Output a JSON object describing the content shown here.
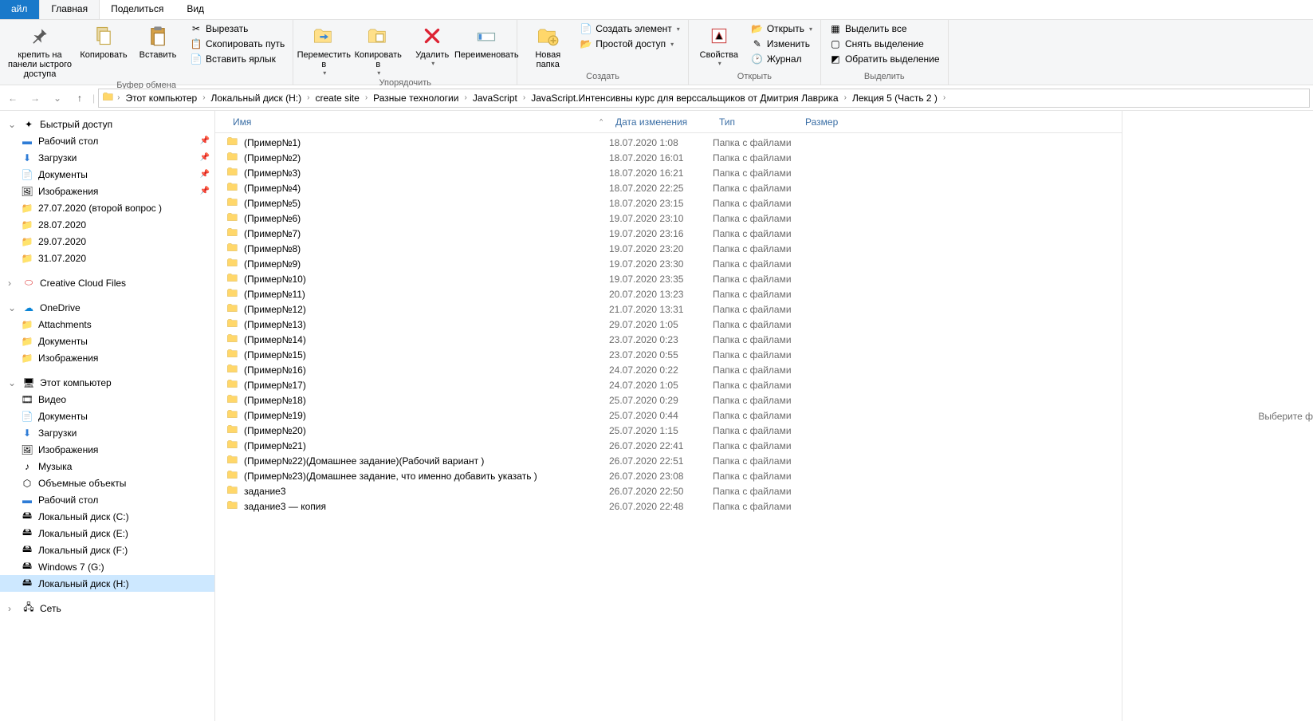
{
  "tabs": {
    "file": "айл",
    "home": "Главная",
    "share": "Поделиться",
    "view": "Вид"
  },
  "ribbon": {
    "clipboard": {
      "pin": "крепить на панели\nыстрого доступа",
      "copy": "Копировать",
      "paste": "Вставить",
      "cut": "Вырезать",
      "copypath": "Скопировать путь",
      "pasteshortcut": "Вставить ярлык",
      "label": "Буфер обмена"
    },
    "organize": {
      "moveto": "Переместить\nв",
      "copyto": "Копировать\nв",
      "delete": "Удалить",
      "rename": "Переименовать",
      "label": "Упорядочить"
    },
    "new": {
      "newfolder": "Новая\nпапка",
      "newitem": "Создать элемент",
      "easyaccess": "Простой доступ",
      "label": "Создать"
    },
    "open": {
      "properties": "Свойства",
      "open": "Открыть",
      "edit": "Изменить",
      "history": "Журнал",
      "label": "Открыть"
    },
    "select": {
      "selectall": "Выделить все",
      "selectnone": "Снять выделение",
      "invert": "Обратить выделение",
      "label": "Выделить"
    }
  },
  "breadcrumbs": [
    "Этот компьютер",
    "Локальный диск (H:)",
    "create site",
    "Разные технологии",
    "JavaScript",
    "JavaScript.Интенсивны курс для версcальщиков от Дмитрия Лаврика",
    "Лекция 5 (Часть 2 )"
  ],
  "nav": {
    "quickaccess": "Быстрый доступ",
    "desktop": "Рабочий стол",
    "downloads": "Загрузки",
    "documents": "Документы",
    "pictures": "Изображения",
    "f1": "27.07.2020 (второй вопрос )",
    "f2": "28.07.2020",
    "f3": "29.07.2020",
    "f4": "31.07.2020",
    "ccf": "Creative Cloud Files",
    "onedrive": "OneDrive",
    "od1": "Attachments",
    "od2": "Документы",
    "od3": "Изображения",
    "thispc": "Этот компьютер",
    "videos": "Видео",
    "tpc_docs": "Документы",
    "tpc_dl": "Загрузки",
    "tpc_pics": "Изображения",
    "tpc_music": "Музыка",
    "tpc_3d": "Объемные объекты",
    "tpc_desktop": "Рабочий стол",
    "diskC": "Локальный диск (C:)",
    "diskE": "Локальный диск (E:)",
    "diskF": "Локальный диск (F:)",
    "diskG": "Windows 7 (G:)",
    "diskH": "Локальный диск (H:)",
    "network": "Сеть"
  },
  "columns": {
    "name": "Имя",
    "date": "Дата изменения",
    "type": "Тип",
    "size": "Размер"
  },
  "preview_hint": "Выберите ф",
  "rows": [
    {
      "name": "(Пример№1)",
      "date": "18.07.2020 1:08",
      "type": "Папка с файлами"
    },
    {
      "name": "(Пример№2)",
      "date": "18.07.2020 16:01",
      "type": "Папка с файлами"
    },
    {
      "name": "(Пример№3)",
      "date": "18.07.2020 16:21",
      "type": "Папка с файлами"
    },
    {
      "name": "(Пример№4)",
      "date": "18.07.2020 22:25",
      "type": "Папка с файлами"
    },
    {
      "name": "(Пример№5)",
      "date": "18.07.2020 23:15",
      "type": "Папка с файлами"
    },
    {
      "name": "(Пример№6)",
      "date": "19.07.2020 23:10",
      "type": "Папка с файлами"
    },
    {
      "name": "(Пример№7)",
      "date": "19.07.2020 23:16",
      "type": "Папка с файлами"
    },
    {
      "name": "(Пример№8)",
      "date": "19.07.2020 23:20",
      "type": "Папка с файлами"
    },
    {
      "name": "(Пример№9)",
      "date": "19.07.2020 23:30",
      "type": "Папка с файлами"
    },
    {
      "name": "(Пример№10)",
      "date": "19.07.2020 23:35",
      "type": "Папка с файлами"
    },
    {
      "name": "(Пример№11)",
      "date": "20.07.2020 13:23",
      "type": "Папка с файлами"
    },
    {
      "name": "(Пример№12)",
      "date": "21.07.2020 13:31",
      "type": "Папка с файлами"
    },
    {
      "name": "(Пример№13)",
      "date": "29.07.2020 1:05",
      "type": "Папка с файлами"
    },
    {
      "name": "(Пример№14)",
      "date": "23.07.2020 0:23",
      "type": "Папка с файлами"
    },
    {
      "name": "(Пример№15)",
      "date": "23.07.2020 0:55",
      "type": "Папка с файлами"
    },
    {
      "name": "(Пример№16)",
      "date": "24.07.2020 0:22",
      "type": "Папка с файлами"
    },
    {
      "name": "(Пример№17)",
      "date": "24.07.2020 1:05",
      "type": "Папка с файлами"
    },
    {
      "name": "(Пример№18)",
      "date": "25.07.2020 0:29",
      "type": "Папка с файлами"
    },
    {
      "name": "(Пример№19)",
      "date": "25.07.2020 0:44",
      "type": "Папка с файлами"
    },
    {
      "name": "(Пример№20)",
      "date": "25.07.2020 1:15",
      "type": "Папка с файлами"
    },
    {
      "name": "(Пример№21)",
      "date": "26.07.2020 22:41",
      "type": "Папка с файлами"
    },
    {
      "name": "(Пример№22)(Домашнее задание)(Рабочий вариант )",
      "date": "26.07.2020 22:51",
      "type": "Папка с файлами"
    },
    {
      "name": "(Пример№23)(Домашнее задание, что именно добавить указать )",
      "date": "26.07.2020 23:08",
      "type": "Папка с файлами"
    },
    {
      "name": "задание3",
      "date": "26.07.2020 22:50",
      "type": "Папка с файлами"
    },
    {
      "name": "задание3 — копия",
      "date": "26.07.2020 22:48",
      "type": "Папка с файлами"
    }
  ]
}
